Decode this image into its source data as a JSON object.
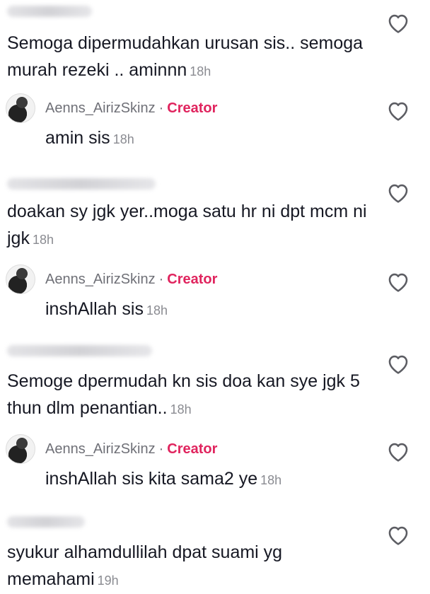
{
  "comments": [
    {
      "type": "comment",
      "text": "Semoga dipermudahkan urusan sis.. semoga murah rezeki .. aminnn",
      "time": "18h"
    },
    {
      "type": "reply",
      "author": "Aenns_AirizSkinz",
      "separator": "·",
      "badge": "Creator",
      "text": "amin sis",
      "time": "18h"
    },
    {
      "type": "comment",
      "text": "doakan sy jgk yer..moga satu hr ni dpt mcm ni jgk",
      "time": "18h"
    },
    {
      "type": "reply",
      "author": "Aenns_AirizSkinz",
      "separator": "·",
      "badge": "Creator",
      "text": "inshAllah sis",
      "time": "18h"
    },
    {
      "type": "comment",
      "text": "Semoge dpermudah kn sis doa kan sye jgk 5 thun dlm penantian..",
      "time": "18h"
    },
    {
      "type": "reply",
      "author": "Aenns_AirizSkinz",
      "separator": "·",
      "badge": "Creator",
      "text": "inshAllah sis kita sama2 ye",
      "time": "18h"
    },
    {
      "type": "comment",
      "text": "syukur alhamdullilah dpat suami yg memahami",
      "time": "19h"
    }
  ],
  "icons": {
    "like": "heart-outline-icon",
    "avatar": "creator-avatar"
  },
  "colors": {
    "text": "#161823",
    "meta": "#8a8b91",
    "creator": "#e0245e"
  }
}
